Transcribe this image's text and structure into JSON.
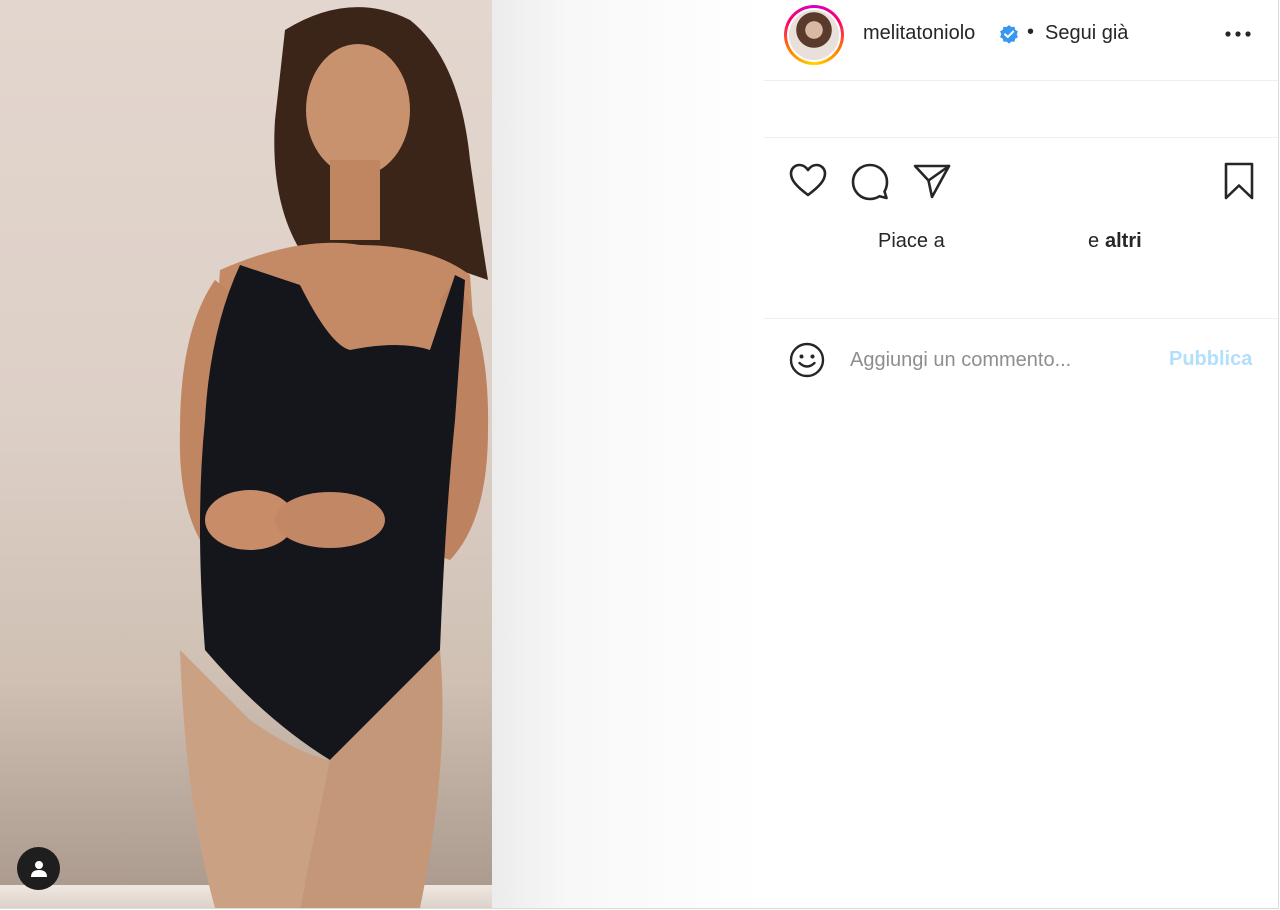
{
  "post": {
    "author": {
      "username": "melitatoniolo",
      "verified_icon": "verified-badge-icon",
      "separator": "•",
      "follow_status": "Segui già",
      "accent_color": "#3897f0"
    },
    "more_icon": "more-options-icon",
    "media": {
      "tag_icon": "user-tag-icon"
    },
    "actions": {
      "like_icon": "heart-icon",
      "comment_icon": "comment-icon",
      "share_icon": "send-icon",
      "save_icon": "bookmark-icon"
    },
    "likes": {
      "prefix": "Piace a",
      "middle": "e",
      "others": "altri"
    },
    "comment": {
      "emoji_icon": "emoji-icon",
      "placeholder": "Aggiungi un commento...",
      "value": "",
      "publish_label": "Pubblica",
      "publish_color": "#b2dffc"
    }
  }
}
